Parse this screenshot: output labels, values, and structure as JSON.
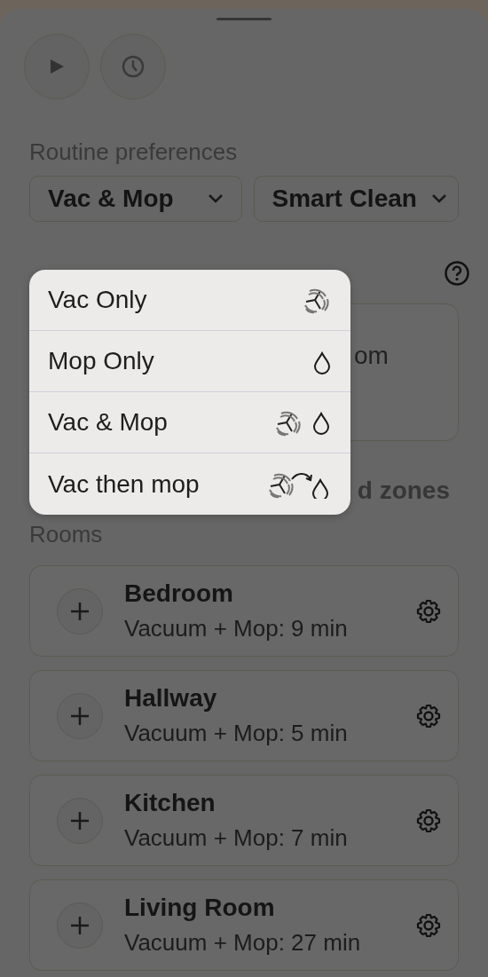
{
  "section_title": "Routine preferences",
  "dropdowns": [
    {
      "label": "Vac & Mop"
    },
    {
      "label": "Smart Clean"
    }
  ],
  "area_card": {
    "text": "om"
  },
  "zones_link": "d zones",
  "rooms_title": "Rooms",
  "rooms": [
    {
      "name": "Bedroom",
      "detail": "Vacuum + Mop: 9 min"
    },
    {
      "name": "Hallway",
      "detail": "Vacuum + Mop: 5 min"
    },
    {
      "name": "Kitchen",
      "detail": "Vacuum + Mop: 7 min"
    },
    {
      "name": "Living Room",
      "detail": "Vacuum + Mop: 27 min"
    }
  ],
  "mode_menu": [
    {
      "label": "Vac Only",
      "kind": "vac"
    },
    {
      "label": "Mop Only",
      "kind": "mop"
    },
    {
      "label": "Vac & Mop",
      "kind": "vac_mop"
    },
    {
      "label": "Vac then mop",
      "kind": "vac_then_mop"
    }
  ]
}
